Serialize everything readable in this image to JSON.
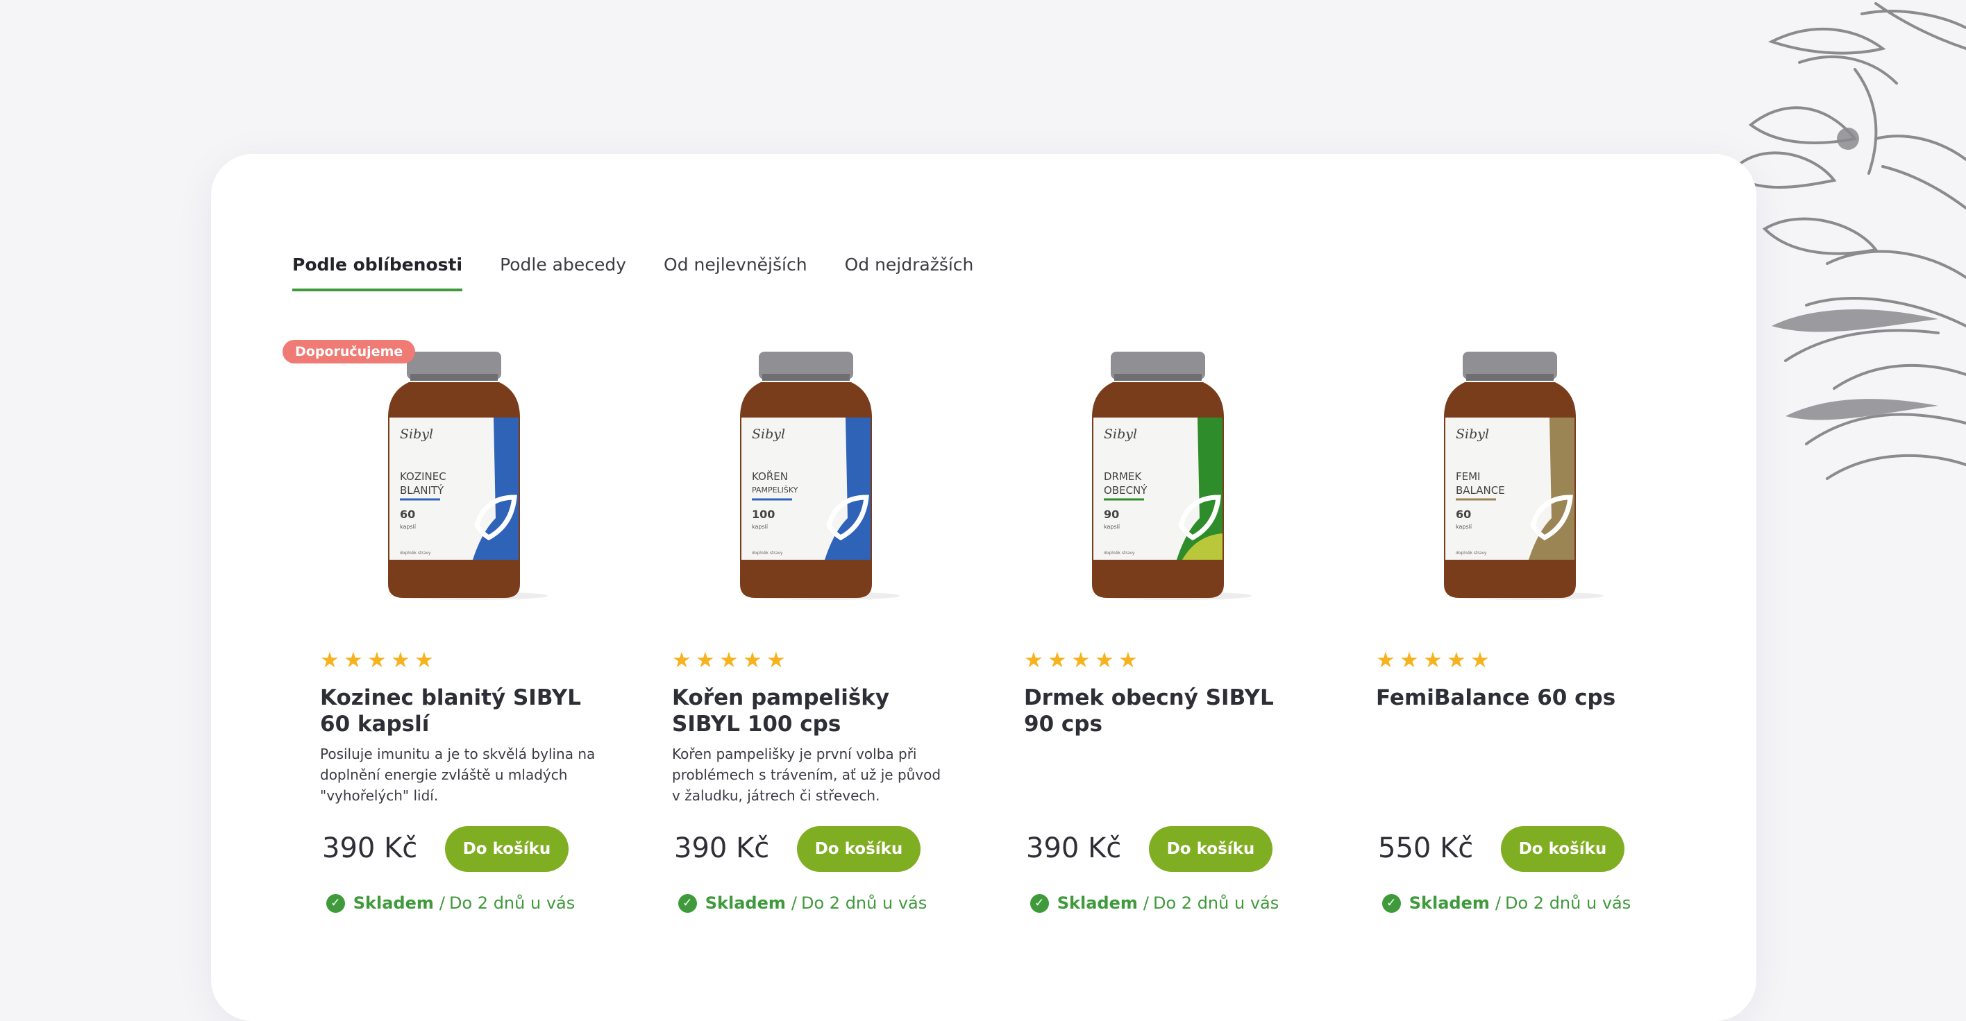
{
  "sort_tabs": [
    {
      "label": "Podle oblíbenosti",
      "active": true
    },
    {
      "label": "Podle abecedy",
      "active": false
    },
    {
      "label": "Od nejlevnějších",
      "active": false
    },
    {
      "label": "Od nejdražších",
      "active": false
    }
  ],
  "products": [
    {
      "badge": "Doporučujeme",
      "rating": 5,
      "name": "Kozinec blanitý SIBYL 60 kapslí",
      "description": "Posiluje imunitu a je to skvělá bylina na doplnění energie zvláště u mladých \"vyhořelých\" lidí.",
      "price": "390 Kč",
      "cart_label": "Do košíku",
      "stock_label": "Skladem",
      "stock_time": "Do 2 dnů u vás",
      "jar": {
        "brand": "Sibyl",
        "line1": "KOZINEC",
        "line2": "BLANITÝ",
        "count": "60",
        "unit": "kapslí",
        "footer": "doplněk stravy",
        "accent": "#2f63b8"
      }
    },
    {
      "badge": "",
      "rating": 5,
      "name": "Kořen pampelišky SIBYL 100 cps",
      "description": "Kořen pampelišky je první volba při problémech s trávením, ať už je původ v žaludku, játrech či střevech.",
      "price": "390 Kč",
      "cart_label": "Do košíku",
      "stock_label": "Skladem",
      "stock_time": "Do 2 dnů u vás",
      "jar": {
        "brand": "Sibyl",
        "line1": "KOŘEN",
        "line2": "PAMPELIŠKY",
        "count": "100",
        "unit": "kapslí",
        "footer": "doplněk stravy",
        "accent": "#2f63b8"
      }
    },
    {
      "badge": "",
      "rating": 5,
      "name": "Drmek obecný SIBYL 90 cps",
      "description": "",
      "price": "390 Kč",
      "cart_label": "Do košíku",
      "stock_label": "Skladem",
      "stock_time": "Do 2 dnů u vás",
      "jar": {
        "brand": "Sibyl",
        "line1": "DRMEK",
        "line2": "OBECNÝ",
        "count": "90",
        "unit": "kapslí",
        "footer": "doplněk stravy",
        "accent": "#2e8c2a"
      }
    },
    {
      "badge": "",
      "rating": 5,
      "name": "FemiBalance 60 cps",
      "description": "",
      "price": "550 Kč",
      "cart_label": "Do košíku",
      "stock_label": "Skladem",
      "stock_time": "Do 2 dnů u vás",
      "jar": {
        "brand": "Sibyl",
        "line1": "FEMI",
        "line2": "BALANCE",
        "count": "60",
        "unit": "kapslí",
        "footer": "doplněk stravy",
        "accent": "#9b8554"
      }
    }
  ],
  "colors": {
    "accent_green": "#3e9a3a",
    "button_green": "#80ae22",
    "badge_red": "#f07a74",
    "star_yellow": "#f6b21f"
  }
}
